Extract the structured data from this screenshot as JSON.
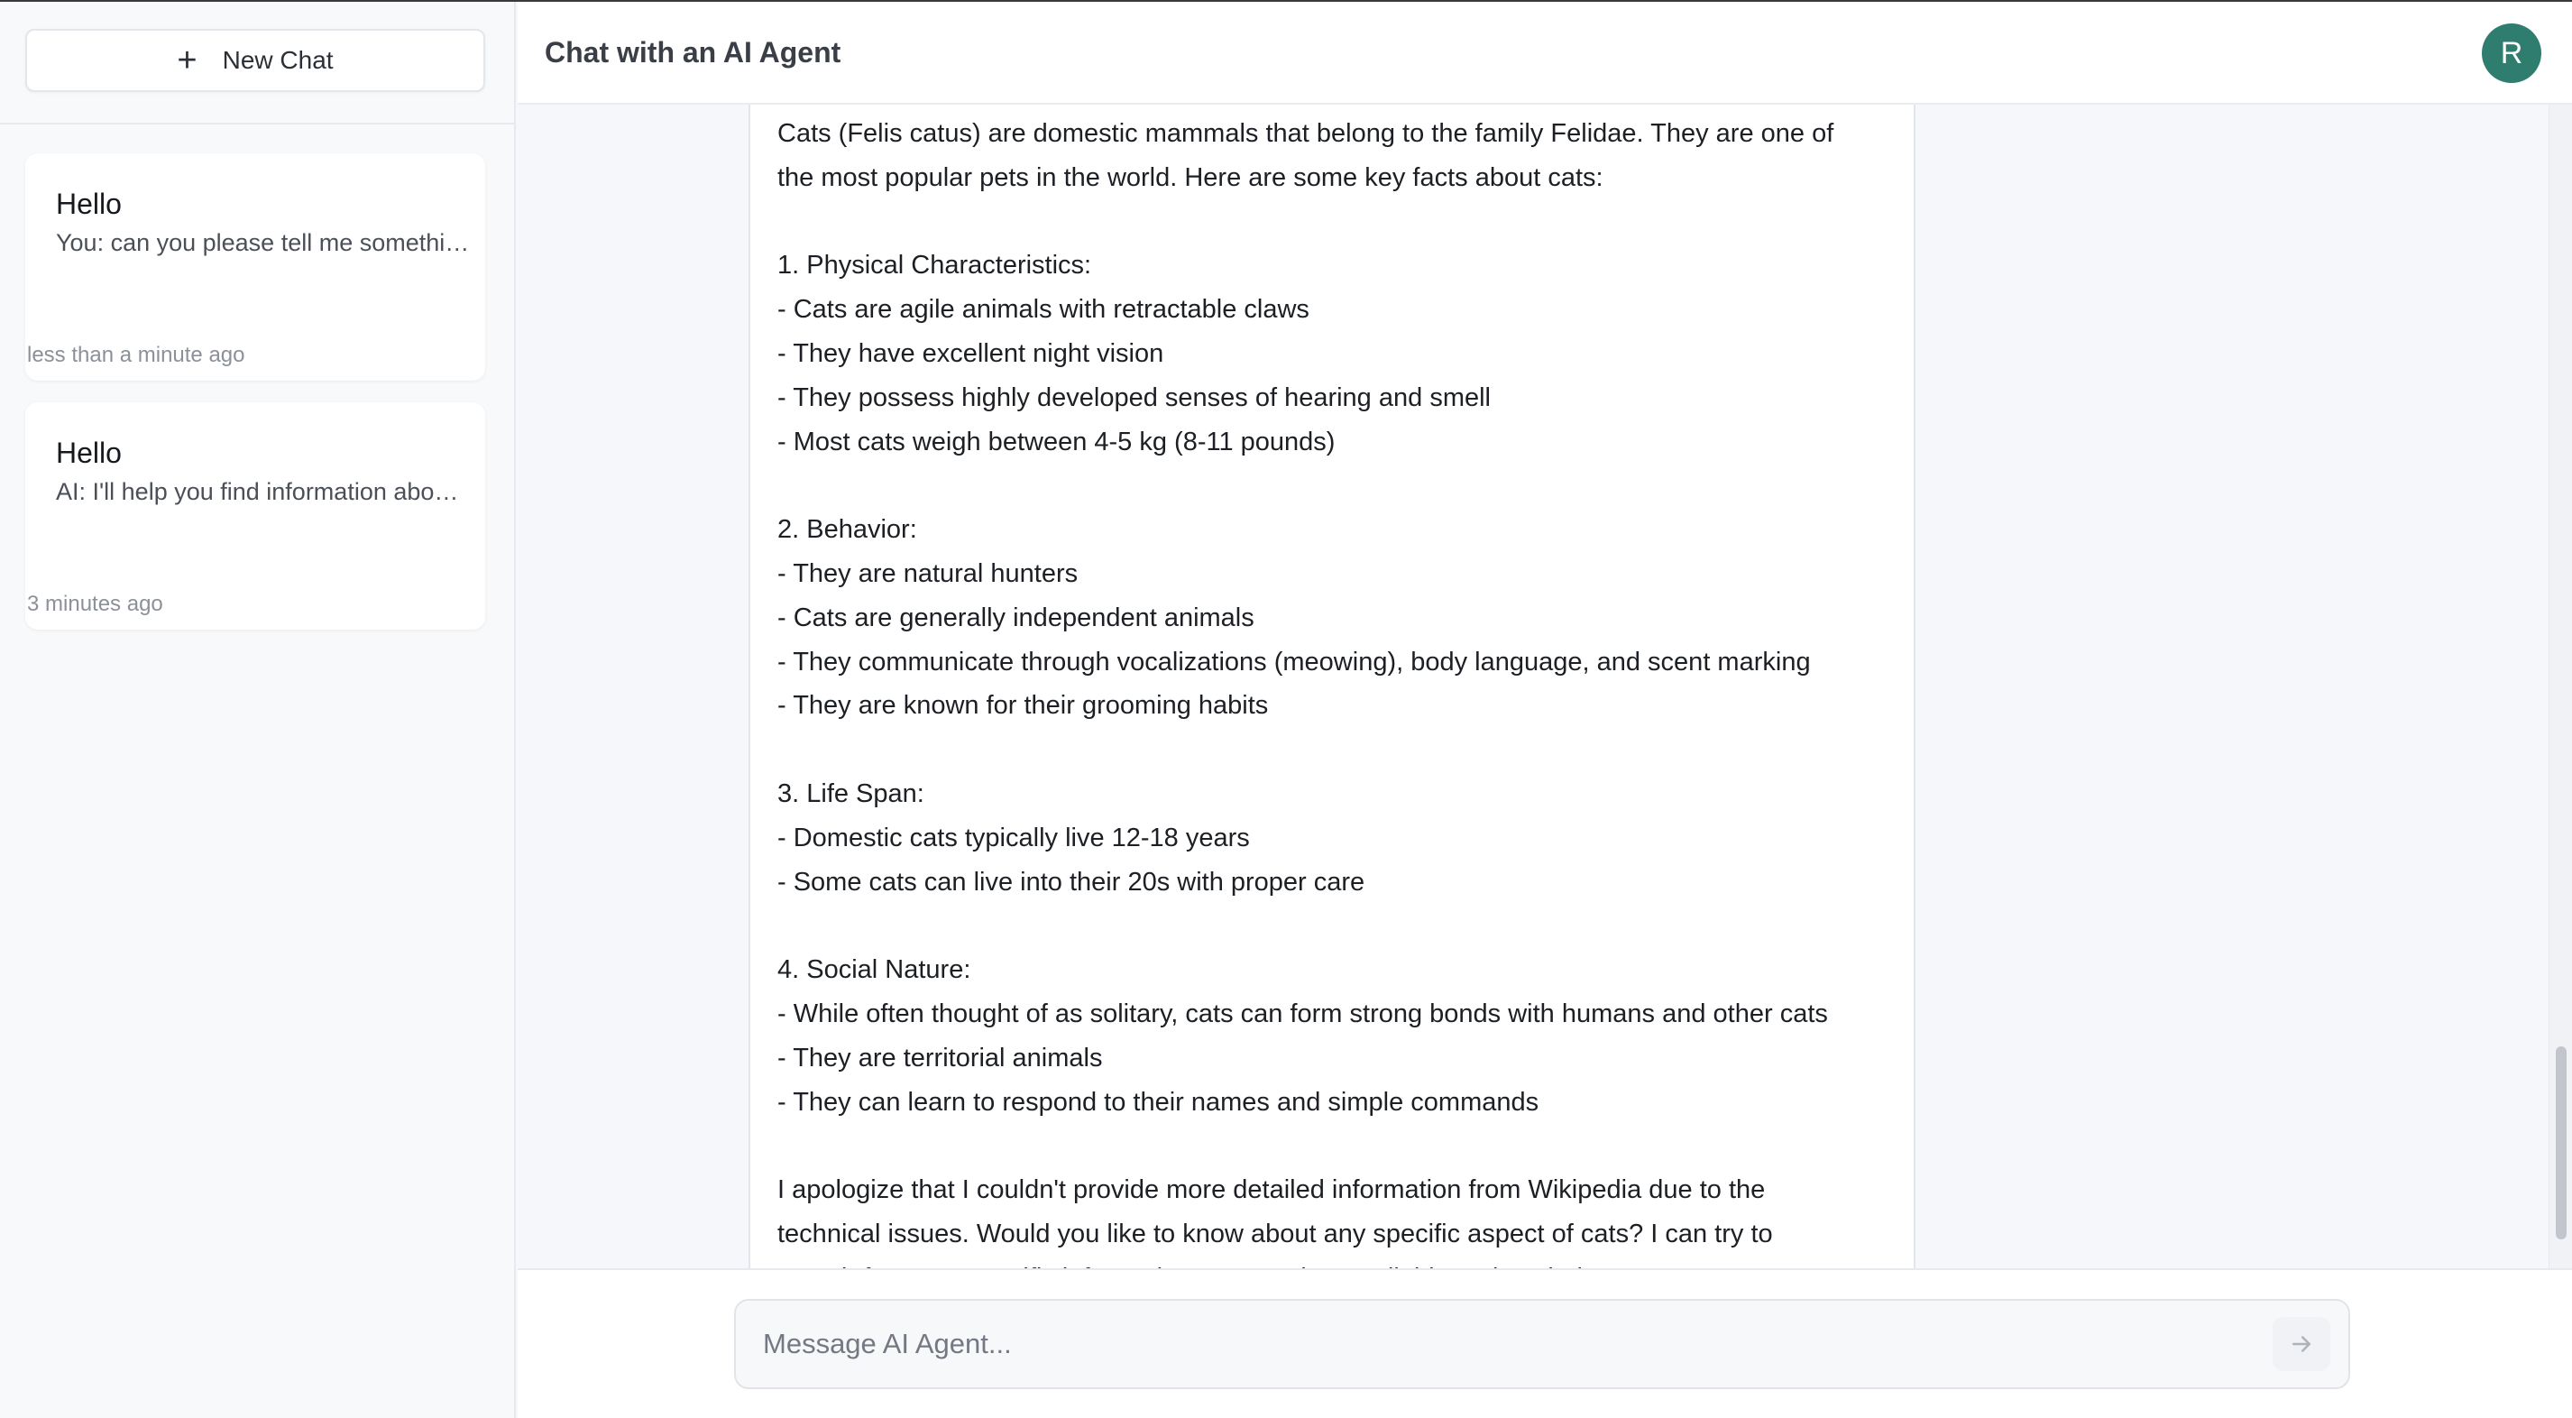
{
  "sidebar": {
    "new_chat_label": "New Chat",
    "chats": [
      {
        "title": "Hello",
        "preview": "You: can you please tell me something about cats",
        "time": "less than a minute ago"
      },
      {
        "title": "Hello",
        "preview": "AI: I'll help you find information about cats",
        "time": "3 minutes ago"
      }
    ]
  },
  "header": {
    "title": "Chat with an AI Agent",
    "avatar_initial": "R",
    "avatar_color": "#2f7d6f"
  },
  "message": {
    "lines": [
      "Cats (Felis catus) are domestic mammals that belong to the family Felidae. They are one of",
      "the most popular pets in the world. Here are some key facts about cats:",
      "",
      "1. Physical Characteristics:",
      "- Cats are agile animals with retractable claws",
      "- They have excellent night vision",
      "- They possess highly developed senses of hearing and smell",
      "- Most cats weigh between 4-5 kg (8-11 pounds)",
      "",
      "2. Behavior:",
      "- They are natural hunters",
      "- Cats are generally independent animals",
      "- They communicate through vocalizations (meowing), body language, and scent marking",
      "- They are known for their grooming habits",
      "",
      "3. Life Span:",
      "- Domestic cats typically live 12-18 years",
      "- Some cats can live into their 20s with proper care",
      "",
      "4. Social Nature:",
      "- While often thought of as solitary, cats can form strong bonds with humans and other cats",
      "- They are territorial animals",
      "- They can learn to respond to their names and simple commands",
      "",
      "I apologize that I couldn't provide more detailed information from Wikipedia due to the",
      "technical issues. Would you like to know about any specific aspect of cats? I can try to",
      "search for more specific information or use other available tools to help answer your"
    ]
  },
  "composer": {
    "placeholder": "Message AI Agent...",
    "send_icon": "arrow-right-icon"
  }
}
